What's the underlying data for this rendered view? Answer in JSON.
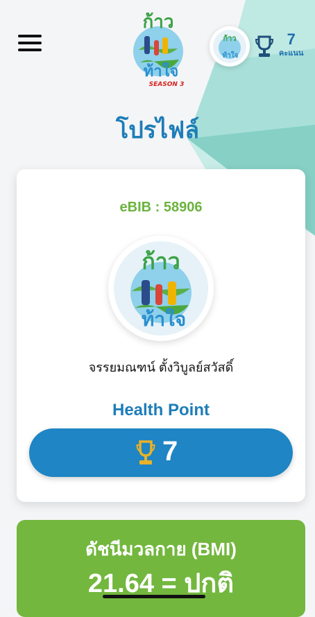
{
  "app": {
    "logo_text": "ก้าวท้าใจ",
    "logo_season": "SEASON 3",
    "colors": {
      "primary_blue": "#1f85c4",
      "title_blue": "#1e7db8",
      "green": "#73b73e",
      "ebib_green": "#6bb33e",
      "teal_bg": "#9fdcd4",
      "trophy_gold": "#d9a21b"
    }
  },
  "header": {
    "menu_icon": "hamburger-menu-icon",
    "score_value": "7",
    "score_label": "คะแนน",
    "trophy_icon": "trophy-icon"
  },
  "page": {
    "title": "โปรไฟล์"
  },
  "profile": {
    "ebib": "eBIB : 58906",
    "name": "จรรยมณฑน์ ตั้งวิบูลย์สวัสดิ์",
    "health_point_label": "Health Point",
    "health_point_value": "7"
  },
  "bmi": {
    "title": "ดัชนีมวลกาย (BMI)",
    "value": "21.64 = ปกติ"
  }
}
